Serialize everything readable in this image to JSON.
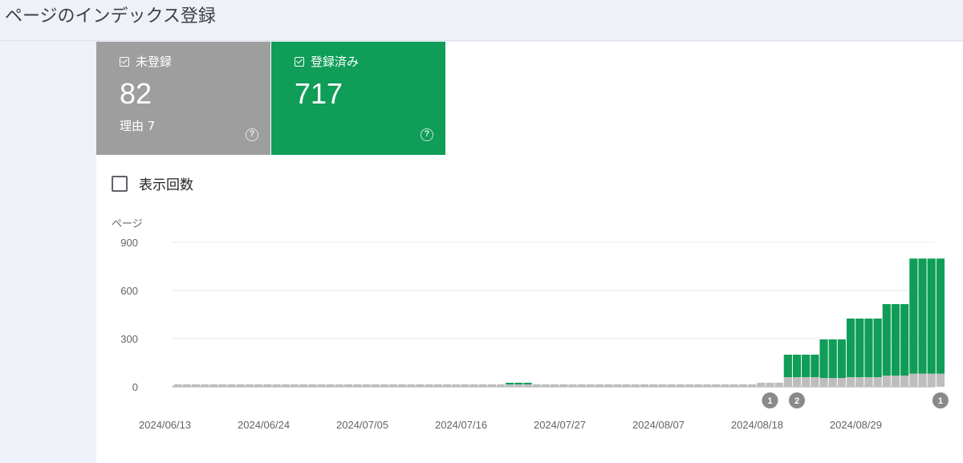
{
  "header": {
    "title": "ページのインデックス登録"
  },
  "cards": {
    "not_indexed": {
      "label": "未登録",
      "value": "82",
      "sub": "理由 7",
      "color": "#9e9e9e"
    },
    "indexed": {
      "label": "登録済み",
      "value": "717",
      "color": "#0f9d58"
    }
  },
  "toggle": {
    "label": "表示回数"
  },
  "icons": {
    "checkbox": "checkbox-checked-icon",
    "help": "help-circle-icon"
  },
  "chart_data": {
    "type": "bar",
    "stacked": true,
    "ylabel": "ページ",
    "ylim": [
      0,
      900
    ],
    "yticks": [
      "900",
      "600",
      "300",
      "0"
    ],
    "ytick_values": [
      900,
      600,
      300,
      0
    ],
    "x_start": "2024-06-13",
    "x_end": "2024-09-07",
    "xtick_labels": [
      "2024/06/13",
      "2024/06/24",
      "2024/07/05",
      "2024/07/16",
      "2024/07/27",
      "2024/08/07",
      "2024/08/18",
      "2024/08/29"
    ],
    "colors": {
      "not_indexed": "#bdbdbd",
      "indexed": "#0f9d58"
    },
    "annotations": [
      {
        "date": "2024-08-18",
        "label": "1"
      },
      {
        "date": "2024-08-21",
        "label": "2"
      },
      {
        "date": "2024-09-06",
        "label": "1"
      }
    ],
    "segments": [
      {
        "from": "2024-06-13",
        "to": "2024-07-19",
        "not_indexed": 15,
        "indexed": 0
      },
      {
        "from": "2024-07-20",
        "to": "2024-07-22",
        "not_indexed": 15,
        "indexed": 10
      },
      {
        "from": "2024-07-23",
        "to": "2024-08-16",
        "not_indexed": 15,
        "indexed": 0
      },
      {
        "from": "2024-08-17",
        "to": "2024-08-19",
        "not_indexed": 25,
        "indexed": 0
      },
      {
        "from": "2024-08-20",
        "to": "2024-08-23",
        "not_indexed": 60,
        "indexed": 140
      },
      {
        "from": "2024-08-24",
        "to": "2024-08-26",
        "not_indexed": 55,
        "indexed": 240
      },
      {
        "from": "2024-08-27",
        "to": "2024-08-30",
        "not_indexed": 60,
        "indexed": 365
      },
      {
        "from": "2024-08-31",
        "to": "2024-09-02",
        "not_indexed": 70,
        "indexed": 445
      },
      {
        "from": "2024-09-03",
        "to": "2024-09-06",
        "not_indexed": 82,
        "indexed": 717
      }
    ]
  }
}
